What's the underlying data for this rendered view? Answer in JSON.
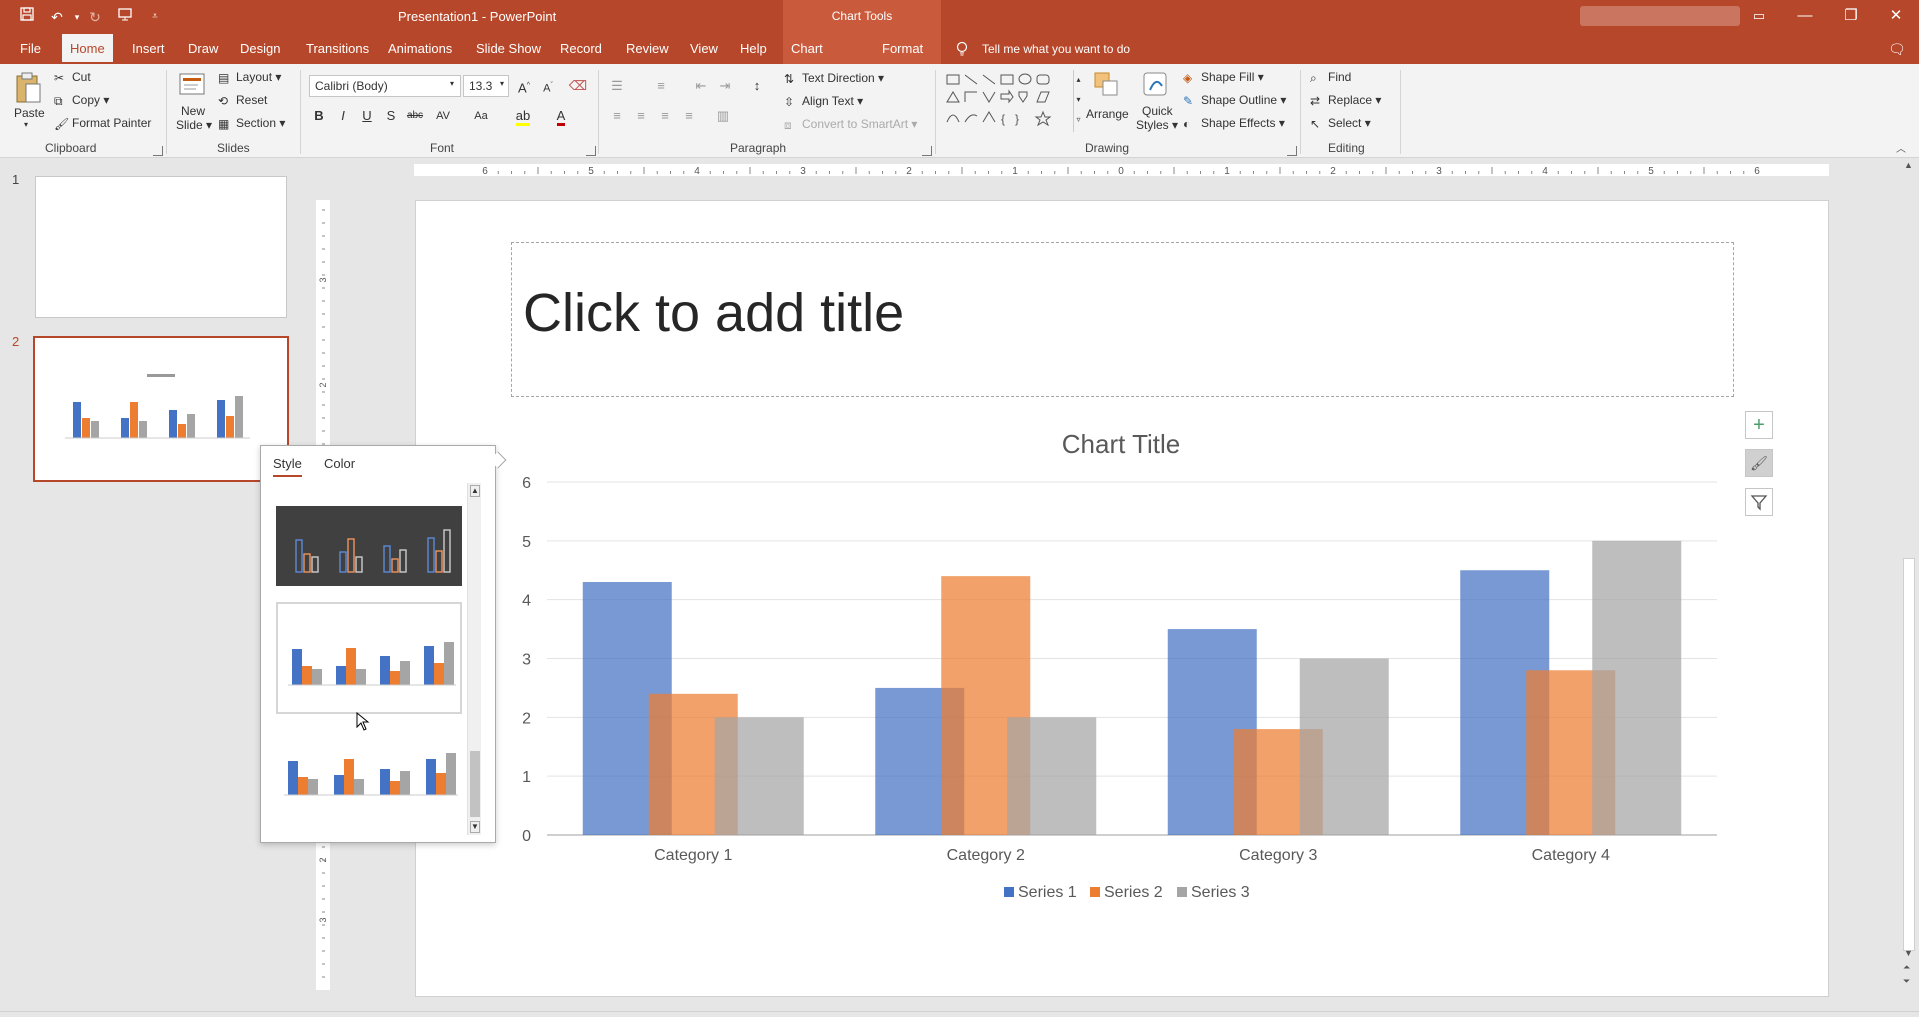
{
  "window": {
    "title": "Presentation1  -  PowerPoint",
    "context_group": "Chart Tools",
    "controls": {
      "minimize": "—",
      "restore": "❐",
      "close": "✕"
    }
  },
  "tabs": [
    "File",
    "Home",
    "Insert",
    "Draw",
    "Design",
    "Transitions",
    "Animations",
    "Slide Show",
    "Record",
    "Review",
    "View",
    "Help",
    "Chart Design",
    "Format"
  ],
  "active_tab": "Home",
  "tell_me": "Tell me what you want to do",
  "ribbon": {
    "clipboard": {
      "paste": "Paste",
      "cut": "Cut",
      "copy": "Copy",
      "format_painter": "Format Painter",
      "label": "Clipboard"
    },
    "slides": {
      "new_slide_1": "New",
      "new_slide_2": "Slide",
      "layout": "Layout",
      "reset": "Reset",
      "section": "Section",
      "label": "Slides"
    },
    "font": {
      "family": "Calibri (Body)",
      "size": "13.3",
      "label": "Font"
    },
    "paragraph": {
      "text_direction": "Text Direction",
      "align_text": "Align Text",
      "convert_smartart": "Convert to SmartArt",
      "label": "Paragraph"
    },
    "drawing": {
      "arrange": "Arrange",
      "quick_styles_1": "Quick",
      "quick_styles_2": "Styles",
      "shape_fill": "Shape Fill",
      "shape_outline": "Shape Outline",
      "shape_effects": "Shape Effects",
      "label": "Drawing"
    },
    "editing": {
      "find": "Find",
      "replace": "Replace",
      "select": "Select",
      "label": "Editing"
    }
  },
  "slides_panel": {
    "slide_numbers": [
      "1",
      "2"
    ]
  },
  "ruler": {
    "top": [
      "6",
      "5",
      "4",
      "3",
      "2",
      "1",
      "0",
      "1",
      "2",
      "3",
      "4",
      "5",
      "6"
    ],
    "left": [
      "3",
      "2",
      "1",
      "2",
      "3"
    ]
  },
  "slide": {
    "title_placeholder": "Click to add title"
  },
  "popup": {
    "tab_style": "Style",
    "tab_color": "Color"
  },
  "colors": {
    "series1": "#4472c4",
    "series2": "#ed7d31",
    "series3": "#a5a5a5",
    "accent": "#b7472a"
  },
  "chart_data": {
    "type": "bar",
    "title": "Chart Title",
    "categories": [
      "Category 1",
      "Category 2",
      "Category 3",
      "Category 4"
    ],
    "series": [
      {
        "name": "Series 1",
        "values": [
          4.3,
          2.5,
          3.5,
          4.5
        ]
      },
      {
        "name": "Series 2",
        "values": [
          2.4,
          4.4,
          1.8,
          2.8
        ]
      },
      {
        "name": "Series 3",
        "values": [
          2,
          2,
          3,
          5
        ]
      }
    ],
    "ylim": [
      0,
      6
    ],
    "yticks": [
      "0",
      "1",
      "2",
      "3",
      "4",
      "5",
      "6"
    ],
    "grid": true,
    "legend": "bottom"
  }
}
